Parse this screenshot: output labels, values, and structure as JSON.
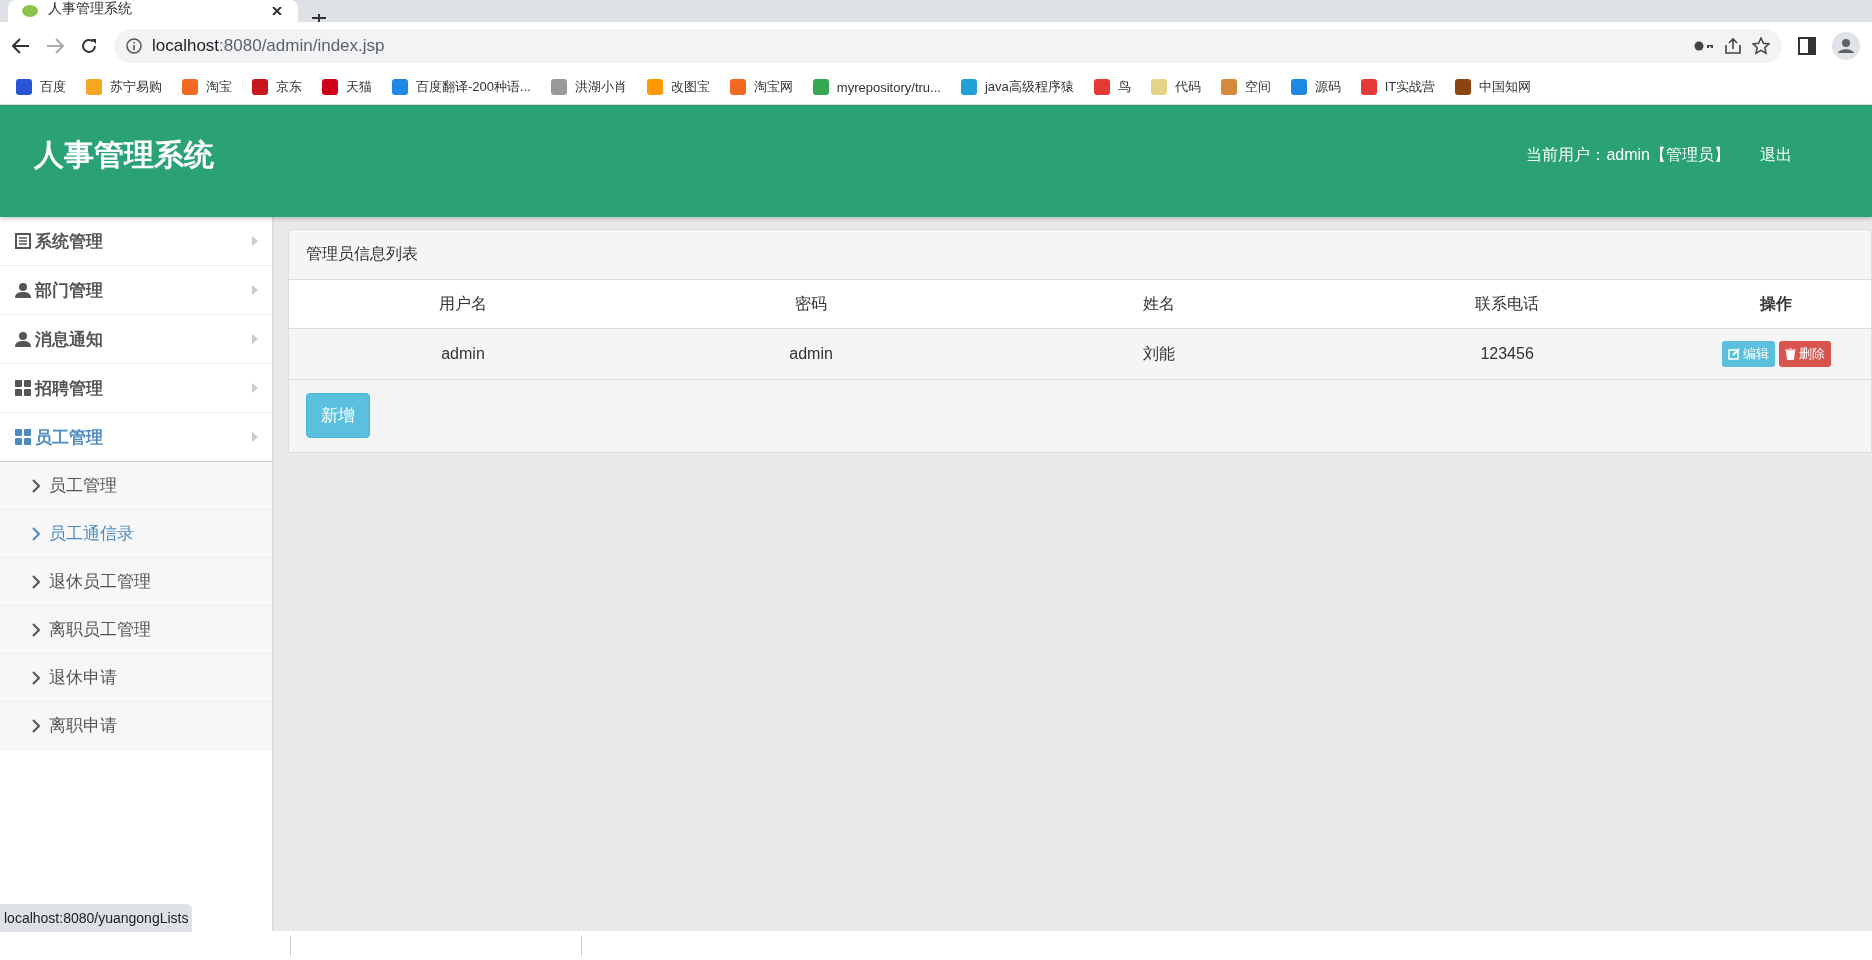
{
  "browser": {
    "tab_title": "人事管理系统",
    "url_host": "localhost",
    "url_path": ":8080/admin/index.jsp",
    "bookmarks": [
      "百度",
      "苏宁易购",
      "淘宝",
      "京东",
      "天猫",
      "百度翻译-200种语...",
      "洪湖小肖",
      "改图宝",
      "淘宝网",
      "myrepository/tru...",
      "java高级程序猿",
      "鸟",
      "代码",
      "空间",
      "源码",
      "IT实战营",
      "中国知网"
    ],
    "status_url": "localhost:8080/yuangongLists"
  },
  "header": {
    "title": "人事管理系统",
    "user": "当前用户：admin【管理员】",
    "logout": "退出"
  },
  "sidebar": {
    "items": [
      {
        "label": "系统管理",
        "kind": "list",
        "expanded": false
      },
      {
        "label": "部门管理",
        "kind": "user",
        "expanded": false
      },
      {
        "label": "消息通知",
        "kind": "user",
        "expanded": false
      },
      {
        "label": "招聘管理",
        "kind": "grid",
        "expanded": false
      },
      {
        "label": "员工管理",
        "kind": "grid",
        "expanded": true,
        "children": [
          {
            "label": "员工管理",
            "selected": false
          },
          {
            "label": "员工通信录",
            "selected": true
          },
          {
            "label": "退休员工管理",
            "selected": false
          },
          {
            "label": "离职员工管理",
            "selected": false
          },
          {
            "label": "退休申请",
            "selected": false
          },
          {
            "label": "离职申请",
            "selected": false
          }
        ]
      }
    ]
  },
  "panel": {
    "title": "管理员信息列表",
    "table": {
      "columns": [
        "用户名",
        "密码",
        "姓名",
        "联系电话",
        "操作"
      ],
      "rows": [
        {
          "cells": [
            "admin",
            "admin",
            "刘能",
            "123456"
          ],
          "actions": [
            {
              "label": "编辑",
              "kind": "edit"
            },
            {
              "label": "删除",
              "kind": "delete"
            }
          ]
        }
      ]
    },
    "add_button": "新增"
  }
}
